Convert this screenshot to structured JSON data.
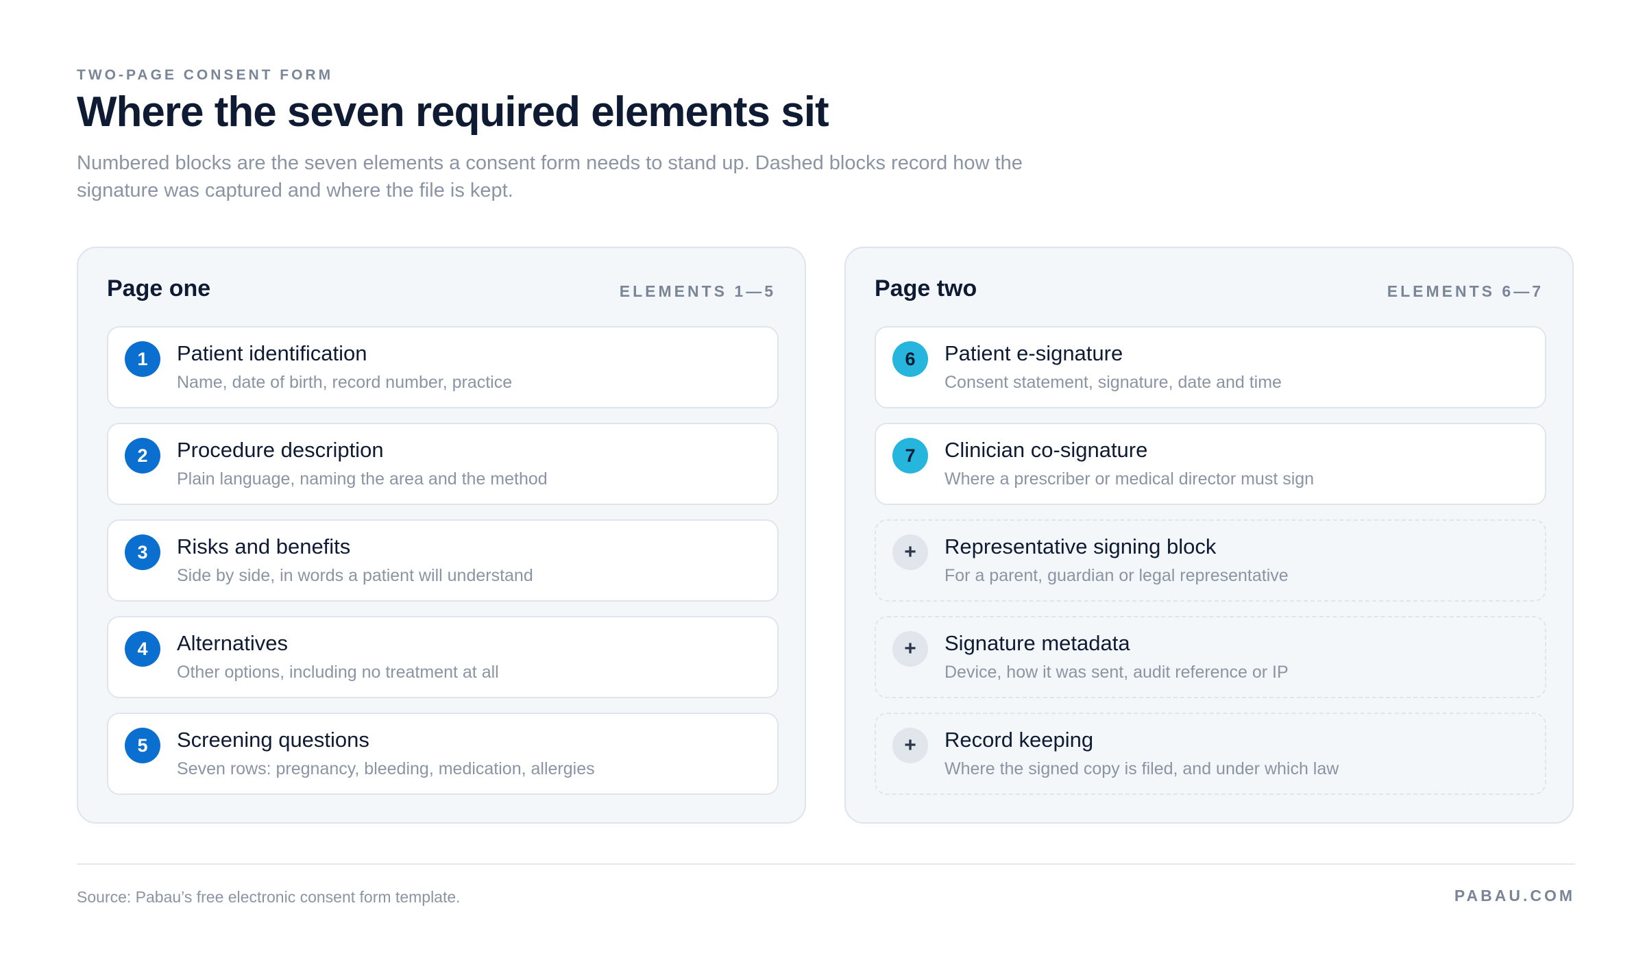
{
  "header": {
    "eyebrow": "TWO-PAGE CONSENT FORM",
    "title": "Where the seven required elements sit",
    "subtitle": "Numbered blocks are the seven elements a consent form needs to stand up. Dashed blocks record how the signature was captured and where the file is kept."
  },
  "colors": {
    "required_page_one": "#0b6fd0",
    "required_page_two": "#26b5dc",
    "optional": "#e1e5ec"
  },
  "pages": [
    {
      "title": "Page one",
      "range": "ELEMENTS 1—5",
      "items": [
        {
          "marker": "1",
          "title": "Patient identification",
          "desc": "Name, date of birth, record number, practice"
        },
        {
          "marker": "2",
          "title": "Procedure description",
          "desc": "Plain language, naming the area and the method"
        },
        {
          "marker": "3",
          "title": "Risks and benefits",
          "desc": "Side by side, in words a patient will understand"
        },
        {
          "marker": "4",
          "title": "Alternatives",
          "desc": "Other options, including no treatment at all"
        },
        {
          "marker": "5",
          "title": "Screening questions",
          "desc": "Seven rows: pregnancy, bleeding, medication, allergies"
        }
      ]
    },
    {
      "title": "Page two",
      "range": "ELEMENTS 6—7",
      "items": [
        {
          "marker": "6",
          "title": "Patient e-signature",
          "desc": "Consent statement, signature, date and time"
        },
        {
          "marker": "7",
          "title": "Clinician co-signature",
          "desc": "Where a prescriber or medical director must sign"
        },
        {
          "marker": "+",
          "title": "Representative signing block",
          "desc": "For a parent, guardian or legal representative"
        },
        {
          "marker": "+",
          "title": "Signature metadata",
          "desc": "Device, how it was sent, audit reference or IP"
        },
        {
          "marker": "+",
          "title": "Record keeping",
          "desc": "Where the signed copy is filed, and under which law"
        }
      ]
    }
  ],
  "footer": {
    "source": "Source: Pabau’s free electronic consent form template.",
    "brand": "PABAU.COM"
  }
}
